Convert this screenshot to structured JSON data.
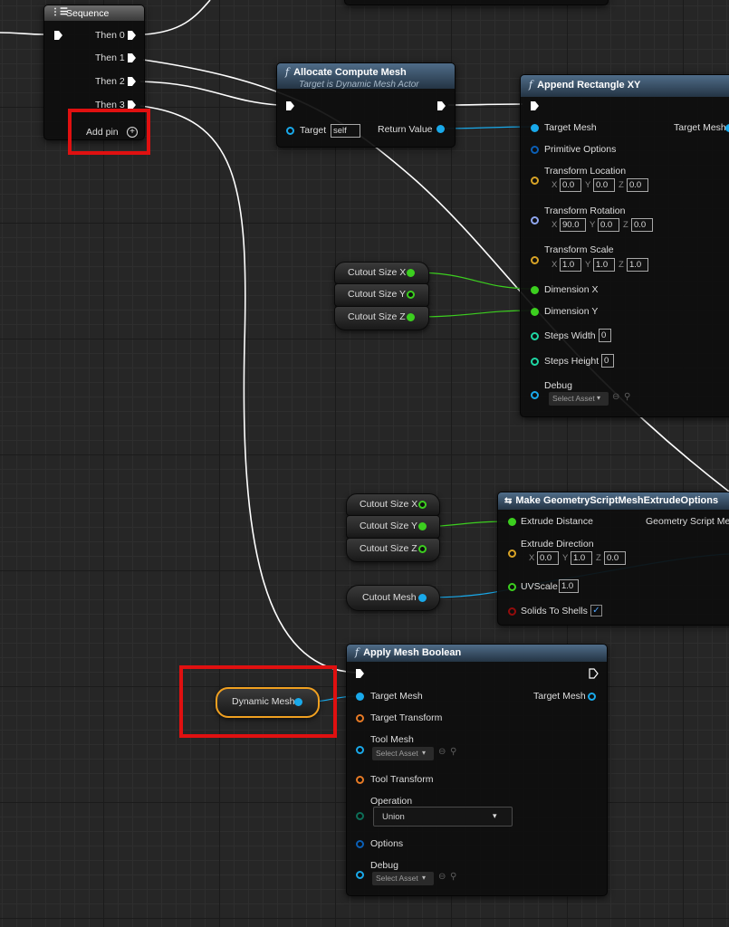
{
  "sequence": {
    "title": "Sequence",
    "outputs": [
      "Then 0",
      "Then 1",
      "Then 2",
      "Then 3"
    ],
    "add_pin": "Add pin"
  },
  "allocate": {
    "title": "Allocate Compute Mesh",
    "subtitle": "Target is Dynamic Mesh Actor",
    "target_label": "Target",
    "target_value": "self",
    "return_label": "Return Value"
  },
  "append": {
    "title": "Append Rectangle XY",
    "target_mesh": "Target Mesh",
    "target_mesh_out": "Target Mesh",
    "primitive_options": "Primitive Options",
    "transform_location": "Transform Location",
    "loc": [
      "0.0",
      "0.0",
      "0.0"
    ],
    "transform_rotation": "Transform Rotation",
    "rot": [
      "90.0",
      "0.0",
      "0.0"
    ],
    "transform_scale": "Transform Scale",
    "scale": [
      "1.0",
      "1.0",
      "1.0"
    ],
    "dimension_x": "Dimension X",
    "dimension_y": "Dimension Y",
    "steps_width": "Steps Width",
    "steps_width_value": "0",
    "steps_height": "Steps Height",
    "steps_height_value": "0",
    "debug": "Debug",
    "select_asset": "Select Asset"
  },
  "axes": {
    "x": "X",
    "y": "Y",
    "z": "Z"
  },
  "cutout_vars_1": [
    "Cutout Size X",
    "Cutout Size Y",
    "Cutout Size Z"
  ],
  "cutout_vars_2": [
    "Cutout Size X",
    "Cutout Size Y",
    "Cutout Size Z"
  ],
  "cutout_mesh": "Cutout Mesh",
  "dynamic_mesh": "Dynamic Mesh",
  "extrude": {
    "title": "Make GeometryScriptMeshExtrudeOptions",
    "extrude_distance": "Extrude Distance",
    "out_label": "Geometry Script Mes",
    "extrude_direction": "Extrude Direction",
    "dir": [
      "0.0",
      "1.0",
      "0.0"
    ],
    "uvscale": "UVScale",
    "uvscale_value": "1.0",
    "solids_to_shells": "Solids To Shells",
    "solids_checked": "✓"
  },
  "boolean": {
    "title": "Apply Mesh Boolean",
    "target_mesh": "Target Mesh",
    "target_mesh_out": "Target Mesh",
    "target_transform": "Target Transform",
    "tool_mesh": "Tool Mesh",
    "select_asset": "Select Asset",
    "tool_transform": "Tool Transform",
    "operation": "Operation",
    "operation_value": "Union",
    "options": "Options",
    "debug": "Debug",
    "select_asset_2": "Select Asset"
  },
  "colors": {
    "exec_wire": "#ffffff",
    "float_pin": "#3ccf1f",
    "object_pin": "#19a9ea",
    "vector_pin": "#d8a326",
    "rotator_pin": "#8fa6ef",
    "transform_pin": "#e77a25",
    "struct_pin": "#0b5fb6",
    "byte_pin": "#0d6e57",
    "int_pin": "#1fd7a4",
    "bool_pin": "#930c0c",
    "highlight": "#e01010"
  }
}
